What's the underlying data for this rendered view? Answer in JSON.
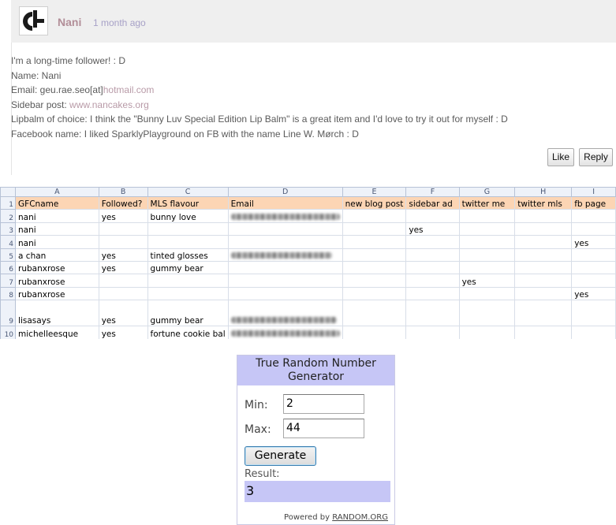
{
  "comment": {
    "author": "Nani",
    "time": "1 month ago",
    "lines": [
      {
        "text": "I'm a long-time follower! : D",
        "link": ""
      },
      {
        "text": "Name: Nani",
        "link": ""
      },
      {
        "text": "Email: geu.rae.seo[at]",
        "link": "hotmail.com"
      },
      {
        "text": "Sidebar post: ",
        "link": "www.nancakes.org"
      },
      {
        "text": "Lipbalm of choice: I think the \"Bunny Luv Special Edition Lip Balm\" is a great item and I'd love to try it out for myself : D",
        "link": ""
      },
      {
        "text": "Facebook name: I liked SparklyPlayground on FB with the name Line W. Mørch : D",
        "link": ""
      }
    ],
    "like_label": "Like",
    "reply_label": "Reply"
  },
  "spreadsheet": {
    "column_letters": [
      "A",
      "B",
      "C",
      "D",
      "E",
      "F",
      "G",
      "H",
      "I"
    ],
    "headers": [
      "GFCname",
      "Followed?",
      "MLS flavour",
      "Email",
      "new blog post",
      "sidebar ad",
      "twitter me",
      "twitter mls",
      "fb page"
    ],
    "rows": [
      {
        "num": "2",
        "cells": [
          "nani",
          "yes",
          "bunny love",
          "",
          "",
          "",
          "",
          "",
          ""
        ]
      },
      {
        "num": "3",
        "cells": [
          "nani",
          "",
          "",
          "",
          "",
          "yes",
          "",
          "",
          ""
        ]
      },
      {
        "num": "4",
        "cells": [
          "nani",
          "",
          "",
          "",
          "",
          "",
          "",
          "",
          "yes"
        ]
      },
      {
        "num": "5",
        "cells": [
          "a chan",
          "yes",
          "tinted glosses",
          "",
          "",
          "",
          "",
          "",
          ""
        ]
      },
      {
        "num": "6",
        "cells": [
          "rubanxrose",
          "yes",
          "gummy bear",
          "",
          "",
          "",
          "",
          "",
          ""
        ]
      },
      {
        "num": "7",
        "cells": [
          "rubanxrose",
          "",
          "",
          "",
          "",
          "",
          "yes",
          "",
          ""
        ]
      },
      {
        "num": "8",
        "cells": [
          "rubanxrose",
          "",
          "",
          "",
          "",
          "",
          "",
          "",
          "yes"
        ]
      },
      {
        "num": "9",
        "cells": [
          "lisasays",
          "yes",
          "gummy bear",
          "",
          "",
          "",
          "",
          "",
          ""
        ]
      },
      {
        "num": "10",
        "cells": [
          "michelleesque",
          "yes",
          "fortune cookie bal",
          "",
          "",
          "",
          "",
          "",
          ""
        ]
      }
    ]
  },
  "rng": {
    "title": "True Random Number Generator",
    "min_label": "Min:",
    "min_value": "2",
    "max_label": "Max:",
    "max_value": "44",
    "generate_label": "Generate",
    "result_label": "Result:",
    "result_value": "3",
    "powered_prefix": "Powered by ",
    "powered_link": "RANDOM.ORG"
  }
}
